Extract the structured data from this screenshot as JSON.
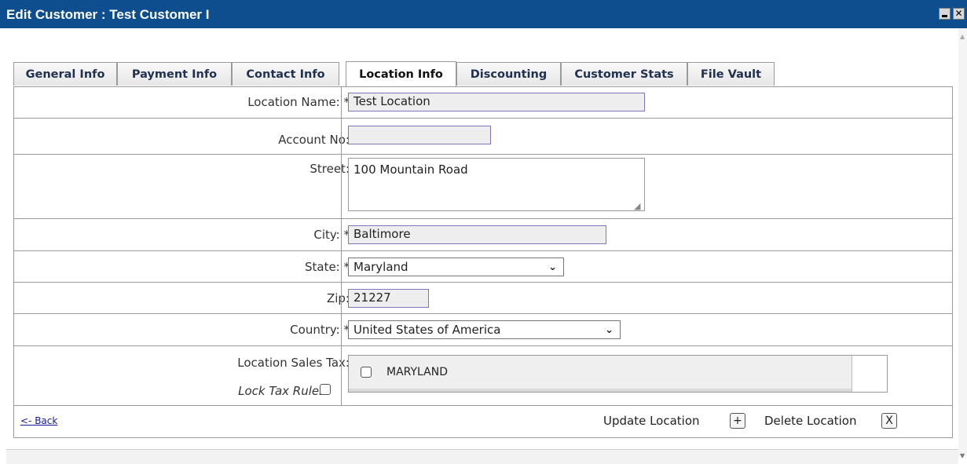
{
  "window": {
    "title": "Edit Customer : Test Customer I",
    "close_glyph": "✕"
  },
  "tabs": [
    {
      "label": "General Info"
    },
    {
      "label": "Payment Info"
    },
    {
      "label": "Contact Info"
    },
    {
      "label": "Location Info",
      "active": true
    },
    {
      "label": "Discounting"
    },
    {
      "label": "Customer Stats"
    },
    {
      "label": "File Vault"
    }
  ],
  "form": {
    "location_name": {
      "label": "Location Name: *",
      "value": "Test Location"
    },
    "account_no": {
      "label": "Account No:",
      "value": ""
    },
    "street": {
      "label": "Street:",
      "value": "100 Mountain Road"
    },
    "city": {
      "label": "City: *",
      "value": "Baltimore"
    },
    "state": {
      "label": "State: *",
      "selected": "Maryland"
    },
    "zip": {
      "label": "Zip:",
      "value": "21227"
    },
    "country": {
      "label": "Country: *",
      "selected": "United States of America"
    },
    "sales_tax": {
      "label": "Location Sales Tax:",
      "lock_label": "Lock Tax Rules:",
      "rules": [
        {
          "name": "MARYLAND",
          "checked": false
        }
      ]
    }
  },
  "footer": {
    "back": "<- Back",
    "update": "Update Location",
    "update_btn": "+",
    "delete": "Delete Location",
    "delete_btn": "X"
  },
  "icons": {
    "select_arrow": "chevron-down-icon"
  },
  "colors": {
    "titlebar": "#0e4d8e",
    "input_border": "#7b77b8"
  }
}
